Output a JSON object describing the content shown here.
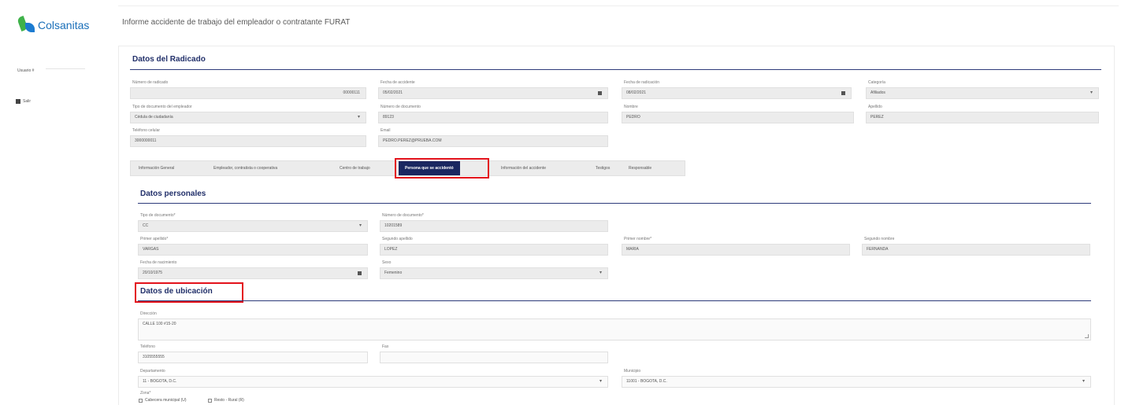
{
  "app": {
    "logo_text": "Colsanitas"
  },
  "page_title": "Informe accidente de trabajo del empleador o contratante FURAT",
  "sidebar": {
    "user_label": "Usuario #",
    "logout_label": "Salir"
  },
  "radicado": {
    "title": "Datos del Radicado",
    "numero_label": "Número de radicado",
    "numero_value": "00000111",
    "fecha_accidente_label": "Fecha de accidente",
    "fecha_accidente_value": "05/02/2021",
    "fecha_radicacion_label": "Fecha de radicación",
    "fecha_radicacion_value": "08/02/2021",
    "categoria_label": "Categoría",
    "categoria_value": "Afiliados",
    "tipo_doc_empleador_label": "Tipo de documento del empleador",
    "tipo_doc_empleador_value": "Cédula de ciudadanía",
    "numero_doc_label": "Número de documento",
    "numero_doc_value": "89123",
    "nombre_label": "Nombre",
    "nombre_value": "PEDRO",
    "apellido_label": "Apellido",
    "apellido_value": "PEREZ",
    "telefono_label": "Teléfono celular",
    "telefono_value": "3000000011",
    "email_label": "Email",
    "email_value": "PEDRO.PEREZ@PRUEBA.COM"
  },
  "tabs": [
    "Información General",
    "Empleador, contratista o cooperativa",
    "Centro de trabajo",
    "Persona que se accidentó",
    "Información del accidente",
    "Testigos",
    "Responsable"
  ],
  "personales": {
    "title": "Datos personales",
    "tipo_doc_label": "Tipo de documento*",
    "tipo_doc_value": "CC",
    "numero_doc_label": "Número de documento*",
    "numero_doc_value": "10201589",
    "primer_apellido_label": "Primer apellido*",
    "primer_apellido_value": "VARGAS",
    "segundo_apellido_label": "Segundo apellido",
    "segundo_apellido_value": "LOPEZ",
    "primer_nombre_label": "Primer nombre*",
    "primer_nombre_value": "MARIA",
    "segundo_nombre_label": "Segundo nombre",
    "segundo_nombre_value": "FERNANDA",
    "fecha_nac_label": "Fecha de nacimiento",
    "fecha_nac_value": "20/10/1975",
    "sexo_label": "Sexo",
    "sexo_value": "Femenino"
  },
  "ubicacion": {
    "title": "Datos de ubicación",
    "direccion_label": "Dirección",
    "direccion_value": "CALLE 100 #15-20",
    "telefono_label": "Teléfono",
    "telefono_value": "3105555555",
    "fax_label": "Fax",
    "departamento_label": "Departamento",
    "departamento_value": "11 - BOGOTA, D.C.",
    "municipio_label": "Municipio",
    "municipio_value": "11001 - BOGOTA, D.C.",
    "zona_label": "Zona*",
    "zona_urbana": "Cabecera municipal (U)",
    "zona_rural": "Resto - Rural (R)"
  }
}
